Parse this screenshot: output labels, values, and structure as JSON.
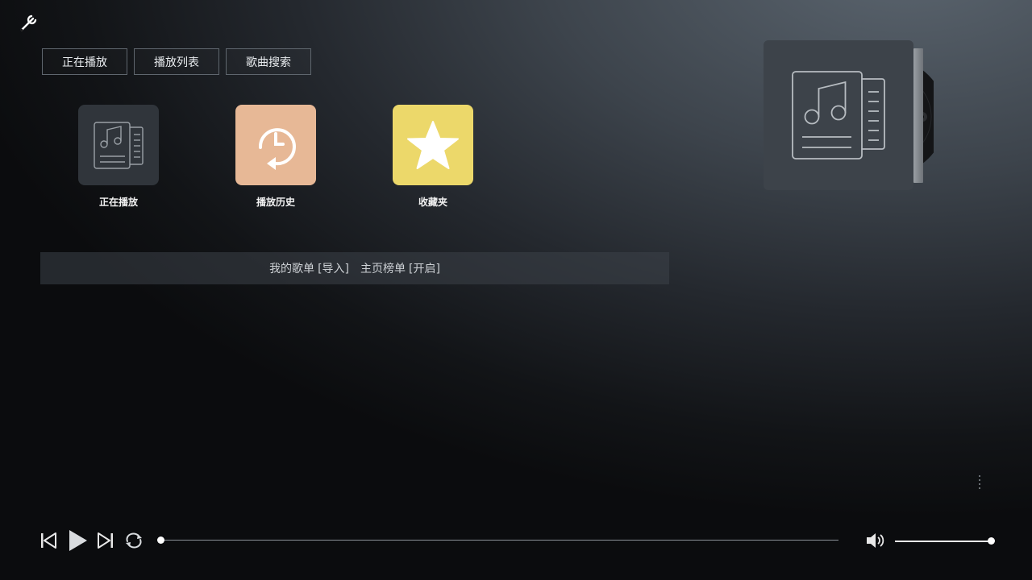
{
  "toolbar": {
    "settings_icon": "wrench-icon"
  },
  "tabs": [
    {
      "label": "正在播放"
    },
    {
      "label": "播放列表"
    },
    {
      "label": "歌曲搜索"
    }
  ],
  "tiles": [
    {
      "label": "正在播放",
      "icon": "music-document-icon",
      "color": "#30353b"
    },
    {
      "label": "播放历史",
      "icon": "history-clock-icon",
      "color": "#e7b896"
    },
    {
      "label": "收藏夹",
      "icon": "star-icon",
      "color": "#ecd86a"
    }
  ],
  "playlist_bar": {
    "my_playlist": "我的歌单",
    "import": "[导入]",
    "home_chart": "主页榜单",
    "open": "[开启]"
  },
  "album": {
    "icon": "music-document-icon"
  },
  "player": {
    "progress": 0.0,
    "volume": 1.0,
    "icons": [
      "previous-icon",
      "play-icon",
      "next-icon",
      "repeat-icon",
      "volume-icon"
    ]
  }
}
